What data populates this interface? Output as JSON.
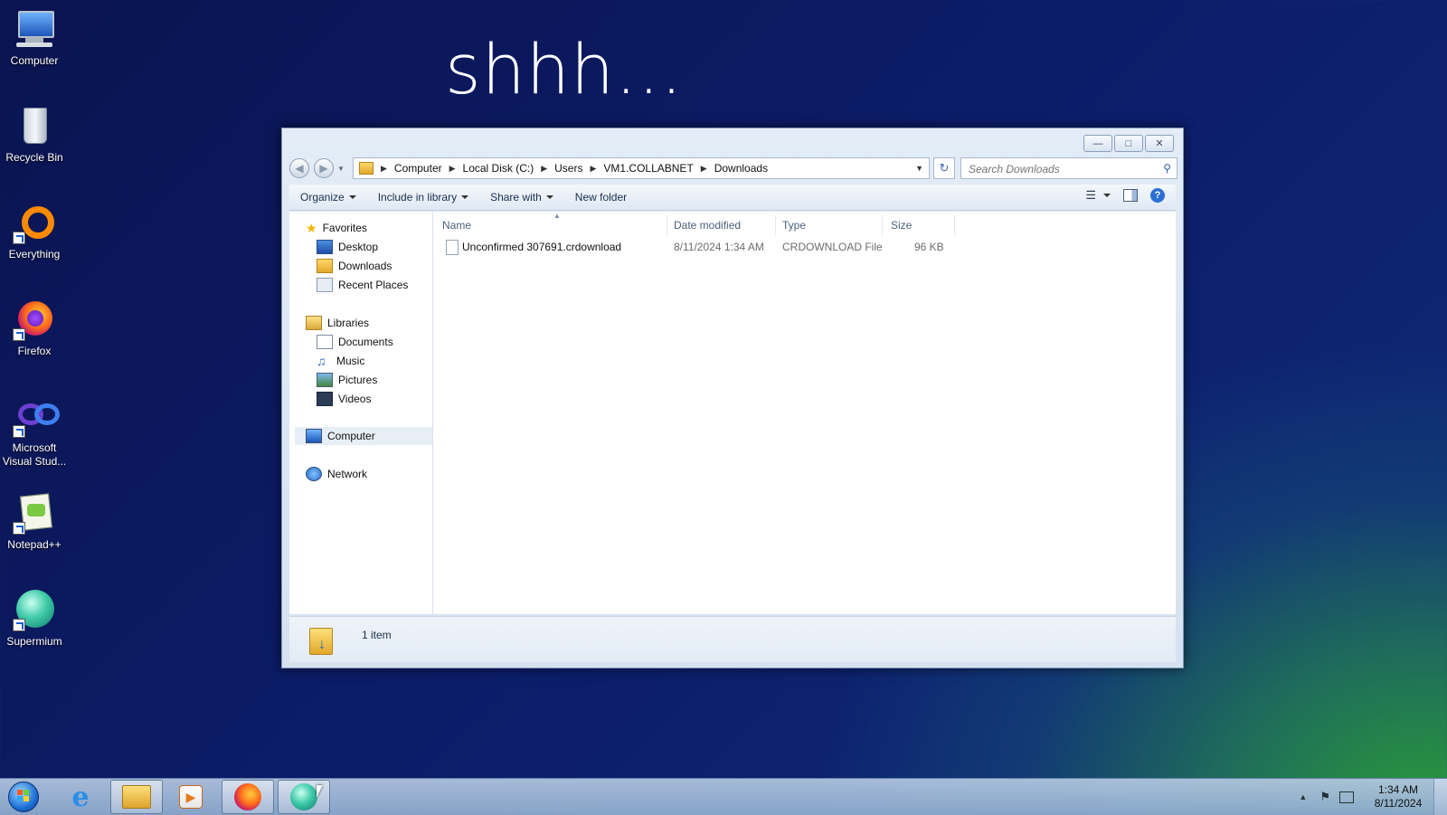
{
  "wallpaper": {
    "text": "shhh..."
  },
  "desktop_icons": [
    {
      "name": "desktop-icon-computer",
      "label": "Computer",
      "icon": "computer-icon"
    },
    {
      "name": "desktop-icon-recycle-bin",
      "label": "Recycle Bin",
      "icon": "recycle-bin-icon"
    },
    {
      "name": "desktop-icon-everything",
      "label": "Everything",
      "icon": "everything-icon"
    },
    {
      "name": "desktop-icon-firefox",
      "label": "Firefox",
      "icon": "firefox-icon"
    },
    {
      "name": "desktop-icon-visual-studio",
      "label": "Microsoft Visual Stud...",
      "icon": "visual-studio-icon"
    },
    {
      "name": "desktop-icon-notepadpp",
      "label": "Notepad++",
      "icon": "notepadpp-icon"
    },
    {
      "name": "desktop-icon-supermium",
      "label": "Supermium",
      "icon": "supermium-icon"
    }
  ],
  "explorer": {
    "breadcrumb": [
      "Computer",
      "Local Disk (C:)",
      "Users",
      "VM1.COLLABNET",
      "Downloads"
    ],
    "search_placeholder": "Search Downloads",
    "toolbar": {
      "organize": "Organize",
      "include_in_library": "Include in library",
      "share_with": "Share with",
      "new_folder": "New folder"
    },
    "nav": {
      "favorites": "Favorites",
      "desktop": "Desktop",
      "downloads": "Downloads",
      "recent_places": "Recent Places",
      "libraries": "Libraries",
      "documents": "Documents",
      "music": "Music",
      "pictures": "Pictures",
      "videos": "Videos",
      "computer": "Computer",
      "network": "Network"
    },
    "columns": {
      "name": "Name",
      "date_modified": "Date modified",
      "type": "Type",
      "size": "Size"
    },
    "files": [
      {
        "name": "Unconfirmed 307691.crdownload",
        "date_modified": "8/11/2024 1:34 AM",
        "type": "CRDOWNLOAD File",
        "size": "96 KB"
      }
    ],
    "status": "1 item"
  },
  "taskbar": {
    "time": "1:34 AM",
    "date": "8/11/2024",
    "pinned": [
      "internet-explorer-icon",
      "file-explorer-icon",
      "media-player-icon",
      "firefox-icon",
      "supermium-icon"
    ]
  }
}
